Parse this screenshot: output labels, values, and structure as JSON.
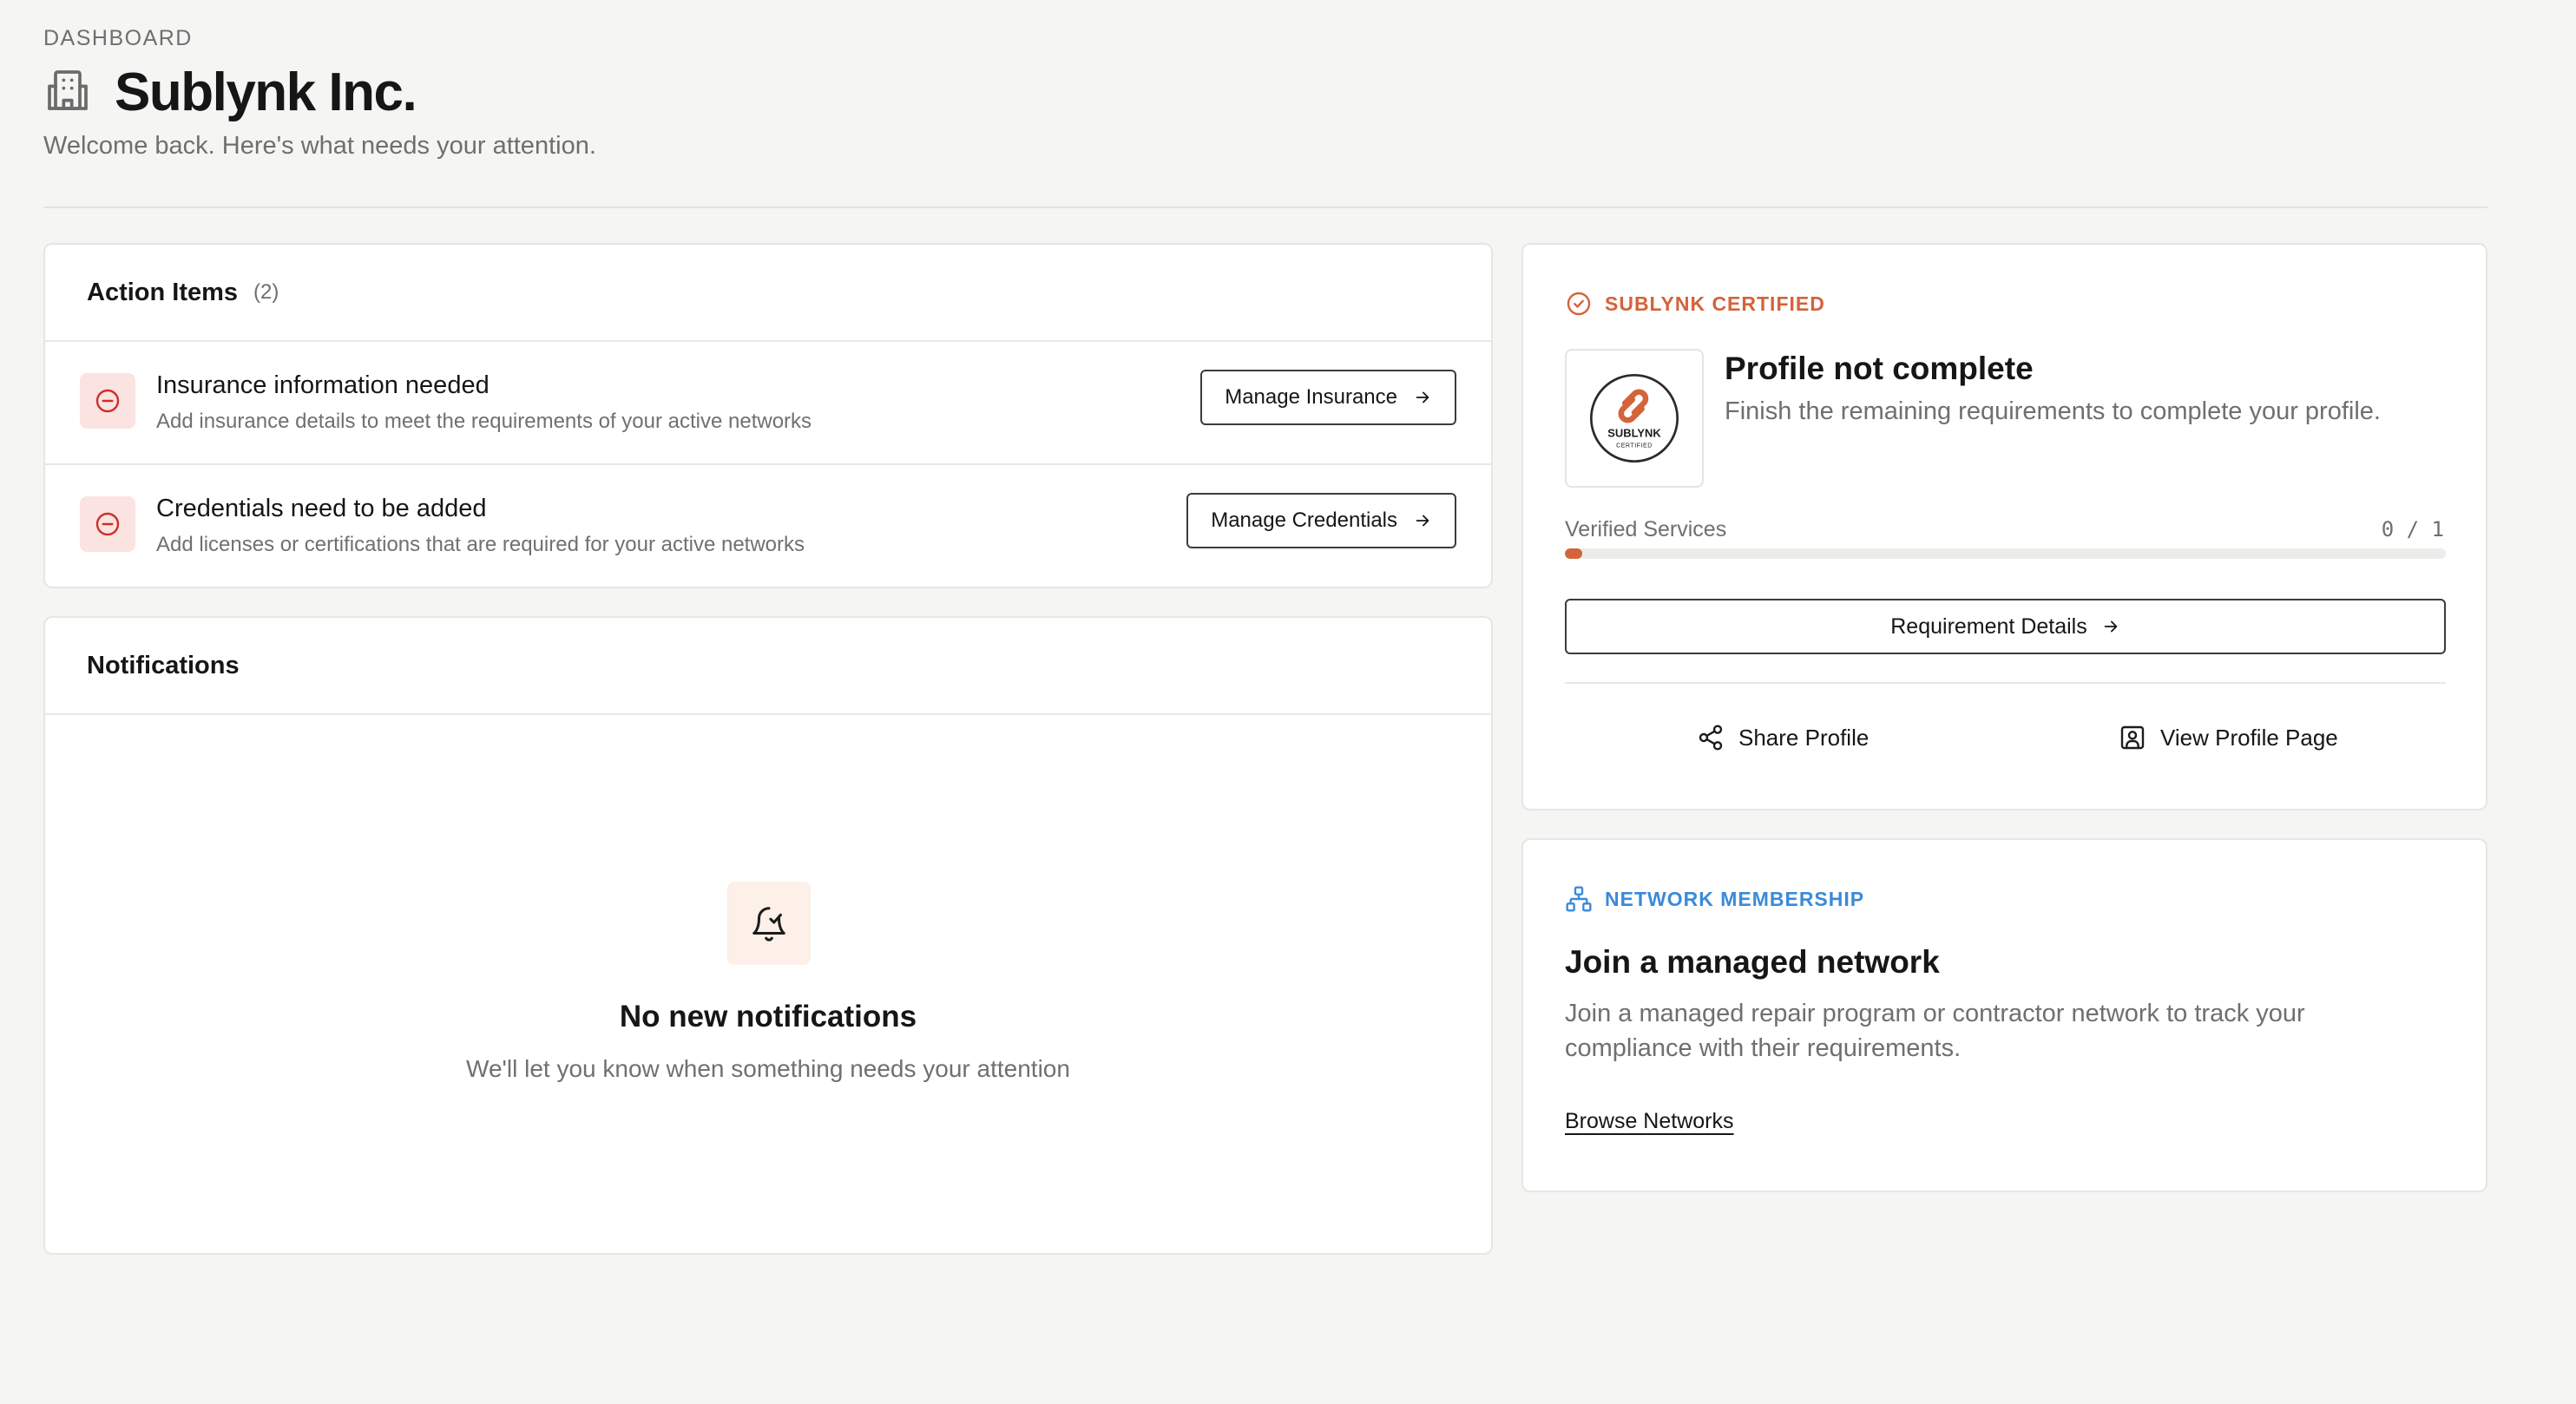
{
  "header": {
    "eyebrow": "DASHBOARD",
    "title": "Sublynk Inc.",
    "subtitle": "Welcome back. Here's what needs your attention.",
    "icon": "building-icon"
  },
  "action_items": {
    "title": "Action Items",
    "count": "(2)",
    "items": [
      {
        "title": "Insurance information needed",
        "description": "Add insurance details to meet the requirements of your active networks",
        "button_label": "Manage Insurance"
      },
      {
        "title": "Credentials need to be added",
        "description": "Add licenses or certifications that are required for your active networks",
        "button_label": "Manage Credentials"
      }
    ]
  },
  "notifications": {
    "title": "Notifications",
    "empty_title": "No new notifications",
    "empty_description": "We'll let you know when something needs your attention"
  },
  "certified": {
    "label": "SUBLYNK CERTIFIED",
    "logo_text": "SUBLYNK",
    "logo_subtext": "CERTIFIED",
    "profile_title": "Profile not complete",
    "profile_description": "Finish the remaining requirements to complete your profile.",
    "progress_label": "Verified Services",
    "progress_value": "0 / 1",
    "progress_fraction": 0.02,
    "requirement_button": "Requirement Details",
    "share_label": "Share Profile",
    "view_label": "View Profile Page"
  },
  "network": {
    "label": "NETWORK MEMBERSHIP",
    "title": "Join a managed network",
    "description": "Join a managed repair program or contractor network to track your compliance with their requirements.",
    "link_label": "Browse Networks"
  },
  "colors": {
    "accent_orange": "#d4633a",
    "accent_blue": "#3b8ad9",
    "alert_red": "#c9302c",
    "background": "#f5f5f3"
  }
}
